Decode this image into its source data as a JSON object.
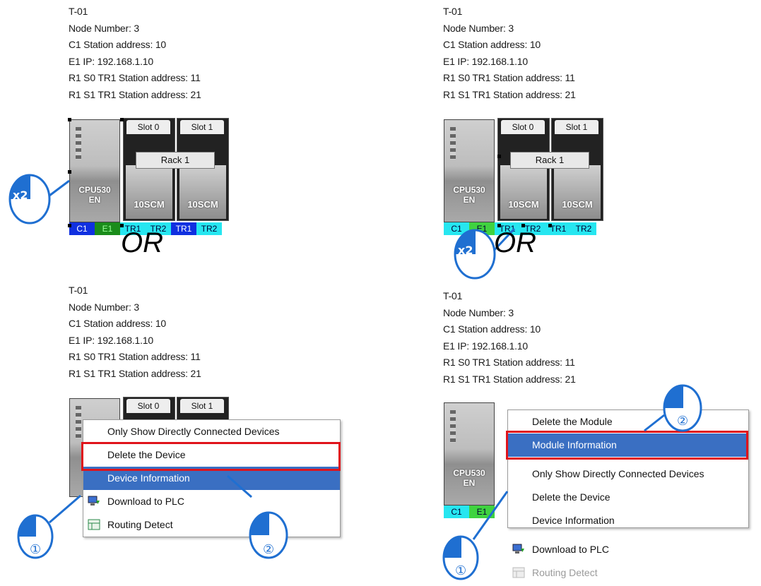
{
  "panels": [
    {
      "name": "T-01",
      "lines": [
        "T-01",
        "Node Number: 3",
        "C1 Station address: 10",
        "E1 IP: 192.168.1.10",
        "R1 S0 TR1 Station address: 11",
        "R1 S1 TR1 Station address: 21"
      ]
    },
    {
      "name": "T-01",
      "lines": [
        "T-01",
        "Node Number: 3",
        "C1 Station address: 10",
        "E1 IP: 192.168.1.10",
        "R1 S0 TR1 Station address: 11",
        "R1 S1 TR1 Station address: 21"
      ]
    },
    {
      "name": "T-01",
      "lines": [
        "T-01",
        "Node Number: 3",
        "C1 Station address: 10",
        "E1 IP: 192.168.1.10",
        "R1 S0 TR1 Station address: 11",
        "R1 S1 TR1 Station address: 21"
      ]
    },
    {
      "name": "T-01",
      "lines": [
        "T-01",
        "Node Number: 3",
        "C1 Station address: 10",
        "E1 IP: 192.168.1.10",
        "R1 S0 TR1 Station address: 11",
        "R1 S1 TR1 Station address: 21"
      ]
    }
  ],
  "device": {
    "cpu": "CPU530\nEN",
    "slot0": "Slot 0",
    "slot1": "Slot 1",
    "rack": "Rack 1",
    "module": "10SCM",
    "ports": [
      "C1",
      "E1",
      "TR1",
      "TR2",
      "TR1",
      "TR2"
    ]
  },
  "or_label": "OR",
  "badges": {
    "double_click": "x2",
    "step1": "①",
    "step2": "②"
  },
  "menu_device": {
    "items": [
      "Only Show Directly Connected Devices",
      "Delete the Device",
      "Device Information",
      "Download to PLC",
      "Routing Detect"
    ],
    "highlighted": "Device Information"
  },
  "menu_module": {
    "items": [
      "Delete the Module",
      "Module Information",
      "Only Show Directly Connected Devices",
      "Delete the Device",
      "Device Information",
      "Download to PLC",
      "Routing Detect"
    ],
    "highlighted": "Module Information",
    "disabled": "Routing Detect"
  },
  "colors": {
    "highlight": "#3a6fc2",
    "callout": "#1f6fd1",
    "redbox": "#e0131b",
    "port_blue": "#1030e0",
    "port_green": "#1fb31f",
    "port_cyan": "#26e6f0"
  }
}
